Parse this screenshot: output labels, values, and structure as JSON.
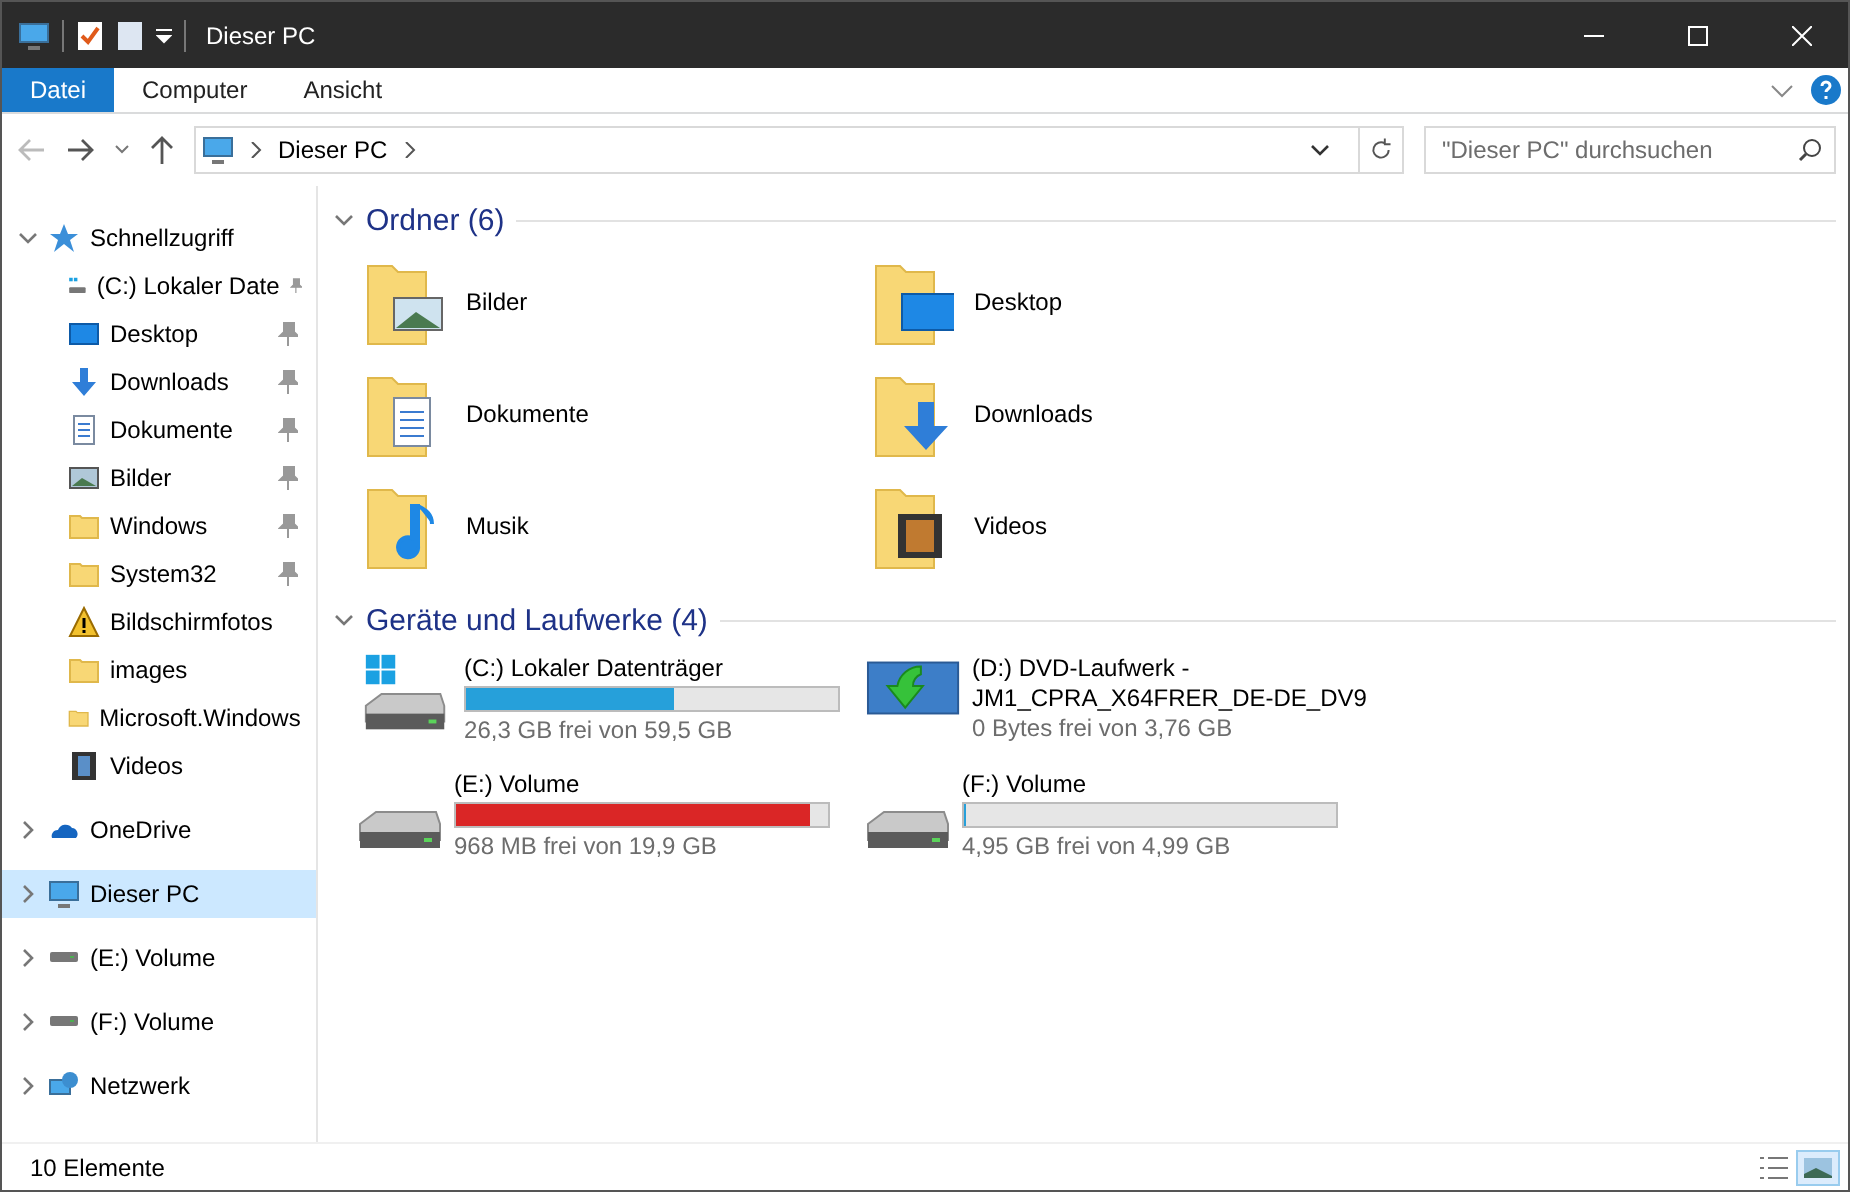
{
  "window": {
    "title": "Dieser PC"
  },
  "ribbon_tabs": [
    {
      "label": "Datei",
      "kind": "file"
    },
    {
      "label": "Computer",
      "kind": "tab"
    },
    {
      "label": "Ansicht",
      "kind": "tab"
    }
  ],
  "address": {
    "path": [
      "Dieser PC"
    ]
  },
  "search": {
    "placeholder": "\"Dieser PC\" durchsuchen"
  },
  "navigation": [
    {
      "label": "Schnellzugriff",
      "kind": "star",
      "expanded": true,
      "selected": false,
      "children": [
        {
          "label": "(C:) Lokaler Date",
          "kind": "windrive",
          "pinned": true,
          "selected": false
        },
        {
          "label": "Desktop",
          "kind": "desktop",
          "pinned": true,
          "selected": false
        },
        {
          "label": "Downloads",
          "kind": "download",
          "pinned": true,
          "selected": false
        },
        {
          "label": "Dokumente",
          "kind": "document",
          "pinned": true,
          "selected": false
        },
        {
          "label": "Bilder",
          "kind": "picture",
          "pinned": true,
          "selected": false
        },
        {
          "label": "Windows",
          "kind": "folder",
          "pinned": true,
          "selected": false
        },
        {
          "label": "System32",
          "kind": "folder",
          "pinned": true,
          "selected": false
        },
        {
          "label": "Bildschirmfotos",
          "kind": "warning",
          "pinned": false,
          "selected": false
        },
        {
          "label": "images",
          "kind": "folder",
          "pinned": false,
          "selected": false
        },
        {
          "label": "Microsoft.Windows",
          "kind": "folder",
          "pinned": false,
          "selected": false
        },
        {
          "label": "Videos",
          "kind": "video",
          "pinned": false,
          "selected": false
        }
      ]
    },
    {
      "label": "OneDrive",
      "kind": "cloud",
      "expanded": false,
      "selected": false
    },
    {
      "label": "Dieser PC",
      "kind": "pc",
      "expanded": false,
      "selected": true
    },
    {
      "label": "(E:) Volume",
      "kind": "drive",
      "expanded": false,
      "selected": false
    },
    {
      "label": "(F:) Volume",
      "kind": "drive",
      "expanded": false,
      "selected": false
    },
    {
      "label": "Netzwerk",
      "kind": "network",
      "expanded": false,
      "selected": false
    }
  ],
  "folders": {
    "heading": "Ordner (6)",
    "expanded": true,
    "items": [
      {
        "label": "Bilder",
        "kind": "picture"
      },
      {
        "label": "Desktop",
        "kind": "desktop"
      },
      {
        "label": "Dokumente",
        "kind": "document"
      },
      {
        "label": "Downloads",
        "kind": "download"
      },
      {
        "label": "Musik",
        "kind": "music"
      },
      {
        "label": "Videos",
        "kind": "video"
      }
    ]
  },
  "drives": {
    "heading": "Geräte und Laufwerke (4)",
    "expanded": true,
    "items": [
      {
        "name": "(C:) Lokaler Datenträger",
        "kind": "windrive",
        "level": 0.558,
        "warning": false,
        "free": "26,3 GB frei von 59,5 GB"
      },
      {
        "name": "(D:) DVD-Laufwerk - JM1_CPRA_X64FRER_DE-DE_DV9",
        "kind": "dvd",
        "free": "0 Bytes frei von 3,76 GB"
      },
      {
        "name": "(E:) Volume",
        "kind": "drive",
        "level": 0.951,
        "warning": true,
        "free": "968 MB frei von 19,9 GB"
      },
      {
        "name": "(F:) Volume",
        "kind": "drive",
        "level": 0.008,
        "warning": false,
        "free": "4,95 GB frei von 4,99 GB"
      }
    ]
  },
  "status_bar": {
    "count": "10 Elemente",
    "views": [
      {
        "kind": "details",
        "selected": false
      },
      {
        "kind": "tiles",
        "selected": true
      }
    ]
  }
}
